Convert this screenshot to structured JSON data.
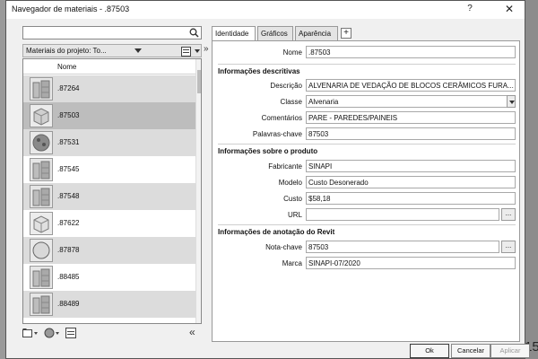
{
  "window": {
    "title": "Navegador de materiais - .87503",
    "help": "?",
    "close": "✕"
  },
  "backdrop": {
    "right_number": "15"
  },
  "left": {
    "search": {
      "value": "",
      "placeholder": ""
    },
    "project_label": "Materiais do projeto: To...",
    "column_header": "Nome",
    "items": [
      {
        "label": ".87264",
        "icon": "brick-wall-icon"
      },
      {
        "label": ".87503",
        "icon": "concrete-block-icon"
      },
      {
        "label": ".87531",
        "icon": "rough-sphere-icon"
      },
      {
        "label": ".87545",
        "icon": "brick-wall-icon"
      },
      {
        "label": ".87548",
        "icon": "brick-wall-icon"
      },
      {
        "label": ".87622",
        "icon": "cube-icon"
      },
      {
        "label": ".87878",
        "icon": "sphere-icon"
      },
      {
        "label": ".88485",
        "icon": "brick-wall-icon"
      },
      {
        "label": ".88489",
        "icon": "brick-wall-icon"
      }
    ],
    "selected_index": 1
  },
  "tabs": [
    {
      "label": "Identidade",
      "active": true
    },
    {
      "label": "Gráficos",
      "active": false
    },
    {
      "label": "Aparência",
      "active": false
    }
  ],
  "add_tab": "+",
  "identity": {
    "name_label": "Nome",
    "name_value": ".87503",
    "descriptive": {
      "heading": "Informações descritivas",
      "description_label": "Descrição",
      "description_value": "ALVENARIA DE VEDAÇÃO DE BLOCOS CERÂMICOS FURA...",
      "class_label": "Classe",
      "class_value": "Alvenaria",
      "comments_label": "Comentários",
      "comments_value": "PARE - PAREDES/PAINEIS",
      "keywords_label": "Palavras-chave",
      "keywords_value": "87503"
    },
    "product": {
      "heading": "Informações sobre o produto",
      "manufacturer_label": "Fabricante",
      "manufacturer_value": "SINAPI",
      "model_label": "Modelo",
      "model_value": "Custo Desonerado",
      "cost_label": "Custo",
      "cost_value": "$58,18",
      "url_label": "URL",
      "url_value": "",
      "url_button": "..."
    },
    "revit": {
      "heading": "Informações de anotação do Revit",
      "keynote_label": "Nota-chave",
      "keynote_value": "87503",
      "keynote_button": "...",
      "mark_label": "Marca",
      "mark_value": "SINAPI-07/2020"
    }
  },
  "footer": {
    "ok": "Ok",
    "cancel": "Cancelar",
    "apply": "Aplicar"
  }
}
